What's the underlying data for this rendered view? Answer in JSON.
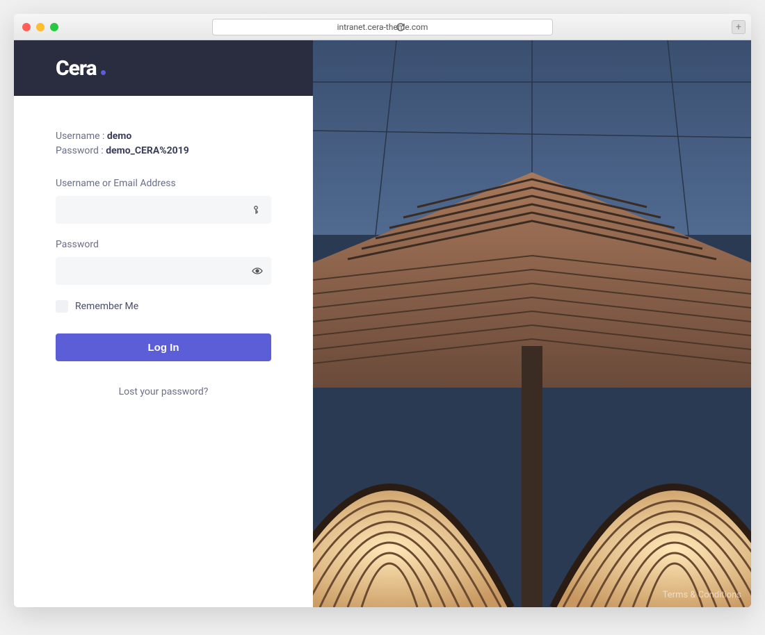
{
  "browser": {
    "url": "intranet.cera-theme.com"
  },
  "logo": {
    "text": "Cera"
  },
  "credentials": {
    "username_label": "Username : ",
    "username_value": "demo",
    "password_label": "Password : ",
    "password_value": "demo_CERA%2019"
  },
  "form": {
    "username_label": "Username or Email Address",
    "password_label": "Password",
    "remember_label": "Remember Me",
    "submit_label": "Log In",
    "lost_password_label": "Lost your password?"
  },
  "footer": {
    "terms_label": "Terms & Conditions"
  },
  "colors": {
    "accent": "#5b5ed6",
    "header_bg": "#2a2c3f",
    "text_muted": "#6b6e8a"
  }
}
